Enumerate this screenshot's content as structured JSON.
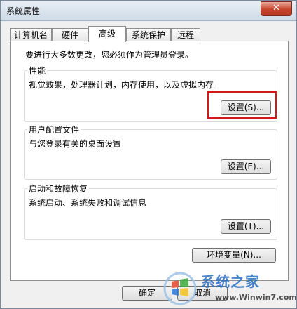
{
  "window": {
    "title": "系统属性",
    "close_label": "✕"
  },
  "tabs": [
    {
      "label": "计算机名",
      "active": false
    },
    {
      "label": "硬件",
      "active": false
    },
    {
      "label": "高级",
      "active": true
    },
    {
      "label": "系统保护",
      "active": false
    },
    {
      "label": "远程",
      "active": false
    }
  ],
  "intro_text": "要进行大多数更改，您必须作为管理员登录。",
  "performance": {
    "title": "性能",
    "description": "视觉效果，处理器计划，内存使用，以及虚拟内存",
    "button_label": "设置(S)..."
  },
  "user_profiles": {
    "title": "用户配置文件",
    "description": "与您登录有关的桌面设置",
    "button_label": "设置(E)..."
  },
  "startup_recovery": {
    "title": "启动和故障恢复",
    "description": "系统启动、系统失败和调试信息",
    "button_label": "设置(T)..."
  },
  "env_button_label": "环境变量(N)...",
  "footer": {
    "ok_label": "确定",
    "cancel_label": "取消"
  },
  "watermark": {
    "text": "系统之家",
    "url": "www.Winwin7.com"
  },
  "colors": {
    "highlight": "#d21a1a",
    "close": "#c7432b",
    "watermark": "#2a6fc2"
  }
}
